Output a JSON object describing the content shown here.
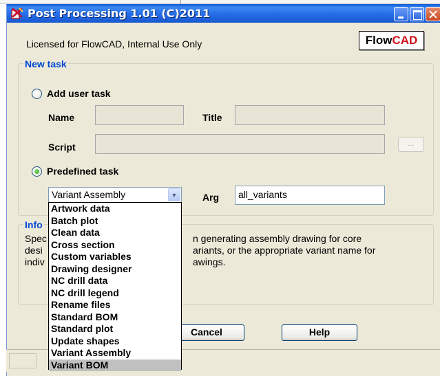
{
  "window": {
    "title": "Post Processing 1.01 (C)2011",
    "app_icon": "postprocess-app-icon",
    "controls": [
      "minimize-icon",
      "maximize-icon",
      "close-icon"
    ]
  },
  "header": {
    "license_text": "Licensed for FlowCAD, Internal Use Only",
    "logo": {
      "flow": "Flow",
      "cad": "CAD",
      "accent_color": "#d0121b"
    }
  },
  "new_task": {
    "legend": "New task",
    "add_user_task": {
      "label": "Add user task",
      "checked": false
    },
    "name_label": "Name",
    "name_value": "",
    "title_label": "Title",
    "title_value": "",
    "script_label": "Script",
    "script_value": "",
    "browse_label": "...",
    "predefined_task": {
      "label": "Predefined task",
      "checked": true
    },
    "task_select": {
      "selected": "Variant Assembly",
      "options": [
        "Artwork data",
        "Batch plot",
        "Clean data",
        "Cross section",
        "Custom variables",
        "Drawing designer",
        "NC drill data",
        "NC drill legend",
        "Rename files",
        "Standard BOM",
        "Standard plot",
        "Update shapes",
        "Variant Assembly",
        "Variant BOM"
      ],
      "highlighted": "Variant BOM"
    },
    "arg_label": "Arg",
    "arg_value": "all_variants"
  },
  "info": {
    "legend": "Info",
    "lines_left": [
      "Spec",
      "desi",
      "indiv"
    ],
    "lines_right": [
      "n generating assembly drawing for core",
      "ariants, or the appropriate variant name for",
      "awings."
    ]
  },
  "buttons": {
    "cancel": "Cancel",
    "help": "Help"
  },
  "colors": {
    "titlebar": "#2a73ea",
    "legend": "#0046d5",
    "dialog_bg": "#ece9d8"
  }
}
